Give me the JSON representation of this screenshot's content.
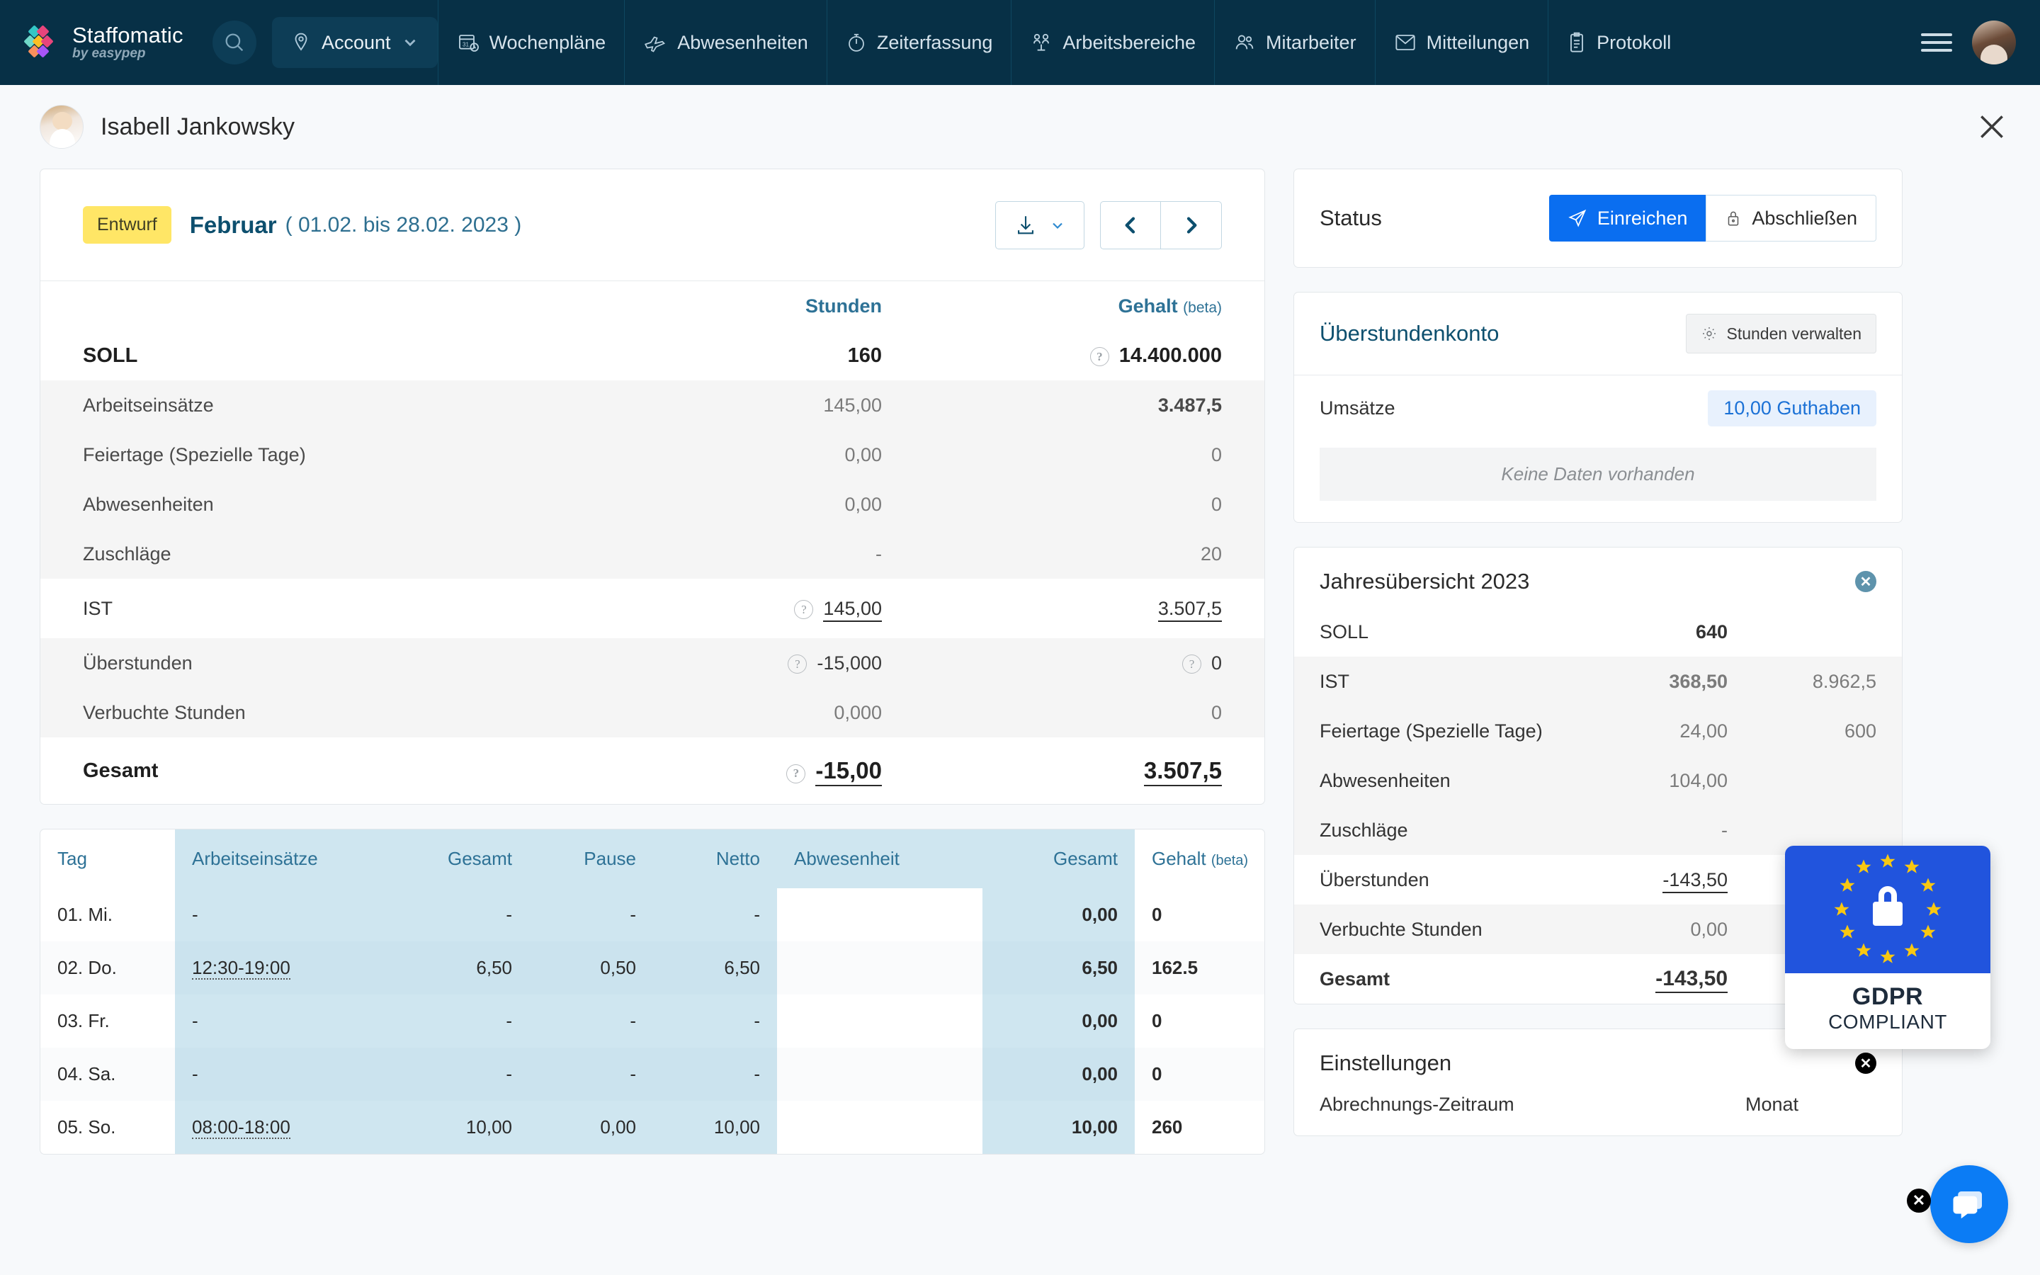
{
  "brand": {
    "name": "Staffomatic",
    "tagline": "by easypep"
  },
  "topnav": {
    "search_label": "search-icon",
    "account_label": "Account",
    "items": [
      {
        "label": "Wochenpläne",
        "icon": "calendar-icon"
      },
      {
        "label": "Abwesenheiten",
        "icon": "plane-icon"
      },
      {
        "label": "Zeiterfassung",
        "icon": "stopwatch-icon"
      },
      {
        "label": "Arbeitsbereiche",
        "icon": "people-areas-icon"
      },
      {
        "label": "Mitarbeiter",
        "icon": "users-icon"
      },
      {
        "label": "Mitteilungen",
        "icon": "envelope-icon"
      },
      {
        "label": "Protokoll",
        "icon": "clipboard-icon"
      }
    ]
  },
  "page": {
    "person_name": "Isabell Jankowsky"
  },
  "period": {
    "status_badge": "Entwurf",
    "month": "Februar",
    "range": "( 01.02. bis 28.02. 2023 )",
    "download_icon": "download-icon",
    "prev_icon": "chevron-left-icon",
    "next_icon": "chevron-right-icon"
  },
  "summary": {
    "headers": {
      "label": "",
      "hours": "Stunden",
      "salary": "Gehalt",
      "salary_beta": "(beta)"
    },
    "rows": [
      {
        "label": "SOLL",
        "hours": "160",
        "salary": "14.400.000",
        "style": "main",
        "hours_help": false,
        "salary_help": true
      },
      {
        "label": "Arbeitseinsätze",
        "hours": "145,00",
        "salary": "3.487,5",
        "style": "shade",
        "hours_help": false,
        "salary_help": false
      },
      {
        "label": "Feiertage (Spezielle Tage)",
        "hours": "0,00",
        "salary": "0",
        "style": "shade",
        "hours_help": false,
        "salary_help": false
      },
      {
        "label": "Abwesenheiten",
        "hours": "0,00",
        "salary": "0",
        "style": "shade",
        "hours_help": false,
        "salary_help": false
      },
      {
        "label": "Zuschläge",
        "hours": "-",
        "salary": "20",
        "style": "shade",
        "hours_help": false,
        "salary_help": false
      },
      {
        "label": "IST",
        "hours": "145,00",
        "salary": "3.507,5",
        "style": "ist",
        "hours_help": true,
        "salary_help": false
      },
      {
        "label": "Überstunden",
        "hours": "-15,000",
        "salary": "0",
        "style": "shade",
        "hours_help": true,
        "salary_help": true
      },
      {
        "label": "Verbuchte Stunden",
        "hours": "0,000",
        "salary": "0",
        "style": "shade",
        "hours_help": false,
        "salary_help": false
      },
      {
        "label": "Gesamt",
        "hours": "-15,00",
        "salary": "3.507,5",
        "style": "total",
        "hours_help": true,
        "salary_help": false
      }
    ]
  },
  "days": {
    "headers": [
      "Tag",
      "Arbeitseinsätze",
      "Gesamt",
      "Pause",
      "Netto",
      "Abwesenheit",
      "Gesamt",
      "Gehalt"
    ],
    "salary_beta": "(beta)",
    "rows": [
      {
        "tag": "01. Mi.",
        "shifts": "-",
        "gesamt": "-",
        "pause": "-",
        "netto": "-",
        "abwesenheit": "",
        "total": "0,00",
        "gehalt": "0"
      },
      {
        "tag": "02. Do.",
        "shifts": "12:30-19:00",
        "gesamt": "6,50",
        "pause": "0,50",
        "netto": "6,50",
        "abwesenheit": "",
        "total": "6,50",
        "gehalt": "162.5"
      },
      {
        "tag": "03. Fr.",
        "shifts": "-",
        "gesamt": "-",
        "pause": "-",
        "netto": "-",
        "abwesenheit": "",
        "total": "0,00",
        "gehalt": "0"
      },
      {
        "tag": "04. Sa.",
        "shifts": "-",
        "gesamt": "-",
        "pause": "-",
        "netto": "-",
        "abwesenheit": "",
        "total": "0,00",
        "gehalt": "0"
      },
      {
        "tag": "05. So.",
        "shifts": "08:00-18:00",
        "gesamt": "10,00",
        "pause": "0,00",
        "netto": "10,00",
        "abwesenheit": "",
        "total": "10,00",
        "gehalt": "260"
      }
    ]
  },
  "status_panel": {
    "title": "Status",
    "submit_label": "Einreichen",
    "submit_icon": "paper-plane-icon",
    "lock_label": "Abschließen",
    "lock_icon": "lock-icon"
  },
  "overtime_panel": {
    "title": "Überstundenkonto",
    "manage_label": "Stunden verwalten",
    "manage_icon": "gear-icon",
    "row_label": "Umsätze",
    "row_value": "10,00 Guthaben",
    "empty_text": "Keine Daten vorhanden"
  },
  "year_panel": {
    "title": "Jahresübersicht 2023",
    "close_icon": "close-circle-icon",
    "rows": [
      {
        "label": "SOLL",
        "hours": "640",
        "salary": "",
        "style": "main"
      },
      {
        "label": "IST",
        "hours": "368,50",
        "salary": "8.962,5",
        "style": "shade"
      },
      {
        "label": "Feiertage (Spezielle Tage)",
        "hours": "24,00",
        "salary": "600",
        "style": "shade"
      },
      {
        "label": "Abwesenheiten",
        "hours": "104,00",
        "salary": "",
        "style": "shade"
      },
      {
        "label": "Zuschläge",
        "hours": "-",
        "salary": "",
        "style": "shade"
      },
      {
        "label": "Überstunden",
        "hours": "-143,50",
        "salary": "",
        "style": "ul"
      },
      {
        "label": "Verbuchte Stunden",
        "hours": "0,00",
        "salary": "",
        "style": "shade"
      },
      {
        "label": "Gesamt",
        "hours": "-143,50",
        "salary": "",
        "style": "total"
      }
    ]
  },
  "settings_panel": {
    "title": "Einstellungen",
    "close_icon": "close-circle-icon",
    "row_label": "Abrechnungs-Zeitraum",
    "row_value": "Monat"
  },
  "gdpr_badge": {
    "line1": "GDPR",
    "line2": "COMPLIANT",
    "icon": "lock-icon"
  },
  "chat": {
    "icon": "chat-bubble-icon",
    "close_icon": "close-icon"
  },
  "colors": {
    "nav_bg": "#073046",
    "accent_blue": "#0a6ef0",
    "link_blue": "#2e7296",
    "draft_yellow": "#ffe666",
    "table_highlight": "#cfe6f0"
  }
}
